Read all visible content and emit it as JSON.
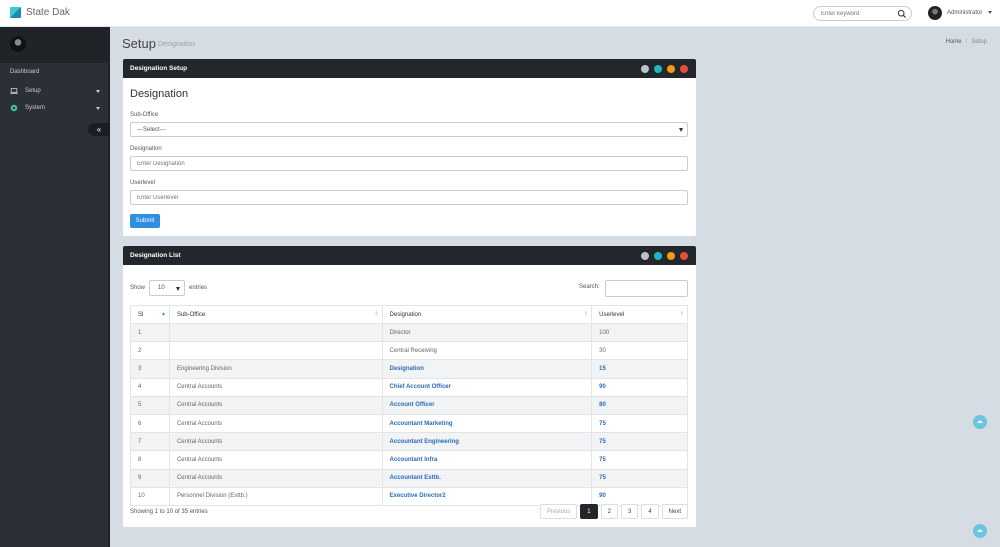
{
  "app": {
    "name": "State Dak"
  },
  "header": {
    "search_placeholder": "Enter keyword",
    "user_name": "Administrator"
  },
  "sidebar": {
    "heading": "Dashboard",
    "items": [
      {
        "label": "Setup",
        "icon": "laptop-icon"
      },
      {
        "label": "System",
        "icon": "gear-icon"
      }
    ]
  },
  "page": {
    "title": "Setup",
    "subtitle": "Designation",
    "breadcrumb": [
      "Home",
      "Setup"
    ]
  },
  "form_panel": {
    "title": "Designation Setup",
    "heading": "Designation",
    "fields": {
      "sub_office_label": "Sub-Office",
      "sub_office_value": "---Select---",
      "designation_label": "Designation",
      "designation_placeholder": "Enter Designation",
      "userlevel_label": "Userlevel",
      "userlevel_placeholder": "Enter Userlevel"
    },
    "submit_label": "Submit"
  },
  "list_panel": {
    "title": "Designation List",
    "show_label": "Show",
    "page_length": "10",
    "entries_label": "entries",
    "search_label": "Search:",
    "columns": [
      "Sl",
      "Sub-Office",
      "Designation",
      "Userlevel"
    ],
    "rows": [
      [
        "1",
        "",
        "Director",
        "100"
      ],
      [
        "2",
        "",
        "Central Receiving",
        "30"
      ],
      [
        "3",
        "Engineering Division",
        "Designation",
        "15"
      ],
      [
        "4",
        "Central Accounts",
        "Chief Account Officer",
        "90"
      ],
      [
        "5",
        "Central Accounts",
        "Account Officer",
        "80"
      ],
      [
        "6",
        "Central Accounts",
        "Accountant Marketing",
        "75"
      ],
      [
        "7",
        "Central Accounts",
        "Accountant Engineering",
        "75"
      ],
      [
        "8",
        "Central Accounts",
        "Accountant Infra",
        "75"
      ],
      [
        "9",
        "Central Accounts",
        "Accountant Esttb.",
        "75"
      ],
      [
        "10",
        "Personnel Division (Esttb.)",
        "Executive Director2",
        "90"
      ]
    ],
    "info": "Showing 1 to 10 of 35 entries",
    "pagination": {
      "previous": "Previous",
      "pages": [
        "1",
        "2",
        "3",
        "4"
      ],
      "next": "Next",
      "current": "1"
    }
  },
  "colors": {
    "accent": "#2f8ee0",
    "panel_header": "#23272b",
    "link_bold": "#2a6db5",
    "tool_colors": [
      "#b8c2cc",
      "#1fb5c8",
      "#f39c12",
      "#e74c3c"
    ]
  }
}
